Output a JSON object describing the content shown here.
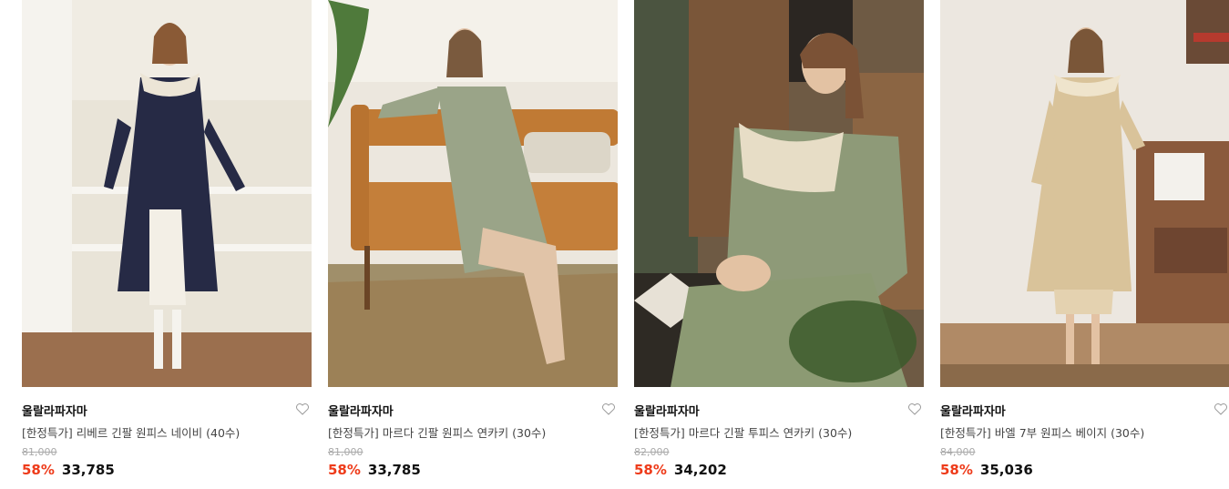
{
  "products": [
    {
      "brand": "울랄라파자마",
      "name": "[한정특가] 리베르 긴팔 원피스 네이비 (40수)",
      "original_price": "81,000",
      "discount": "58%",
      "price": "33,785",
      "colors": {
        "bg": "#e9e4d8",
        "floor": "#9b6f4e",
        "garment": "#262a45"
      }
    },
    {
      "brand": "울랄라파자마",
      "name": "[한정특가] 마르다 긴팔 원피스 연카키 (30수)",
      "original_price": "81,000",
      "discount": "58%",
      "price": "33,785",
      "colors": {
        "bg": "#ece7de",
        "floor": "#a08f6a",
        "garment": "#9aa488"
      }
    },
    {
      "brand": "울랄라파자마",
      "name": "[한정특가] 마르다 긴팔 투피스 연카키 (30수)",
      "original_price": "82,000",
      "discount": "58%",
      "price": "34,202",
      "colors": {
        "bg": "#6e5a44",
        "floor": "#2e2a24",
        "garment": "#8e9a78"
      }
    },
    {
      "brand": "울랄라파자마",
      "name": "[한정특가] 바엘 7부 원피스 베이지 (30수)",
      "original_price": "84,000",
      "discount": "58%",
      "price": "35,036",
      "colors": {
        "bg": "#ece7e0",
        "floor": "#b08a66",
        "garment": "#d9c39a"
      }
    }
  ],
  "icons": {
    "like": "heart-outline-icon"
  }
}
